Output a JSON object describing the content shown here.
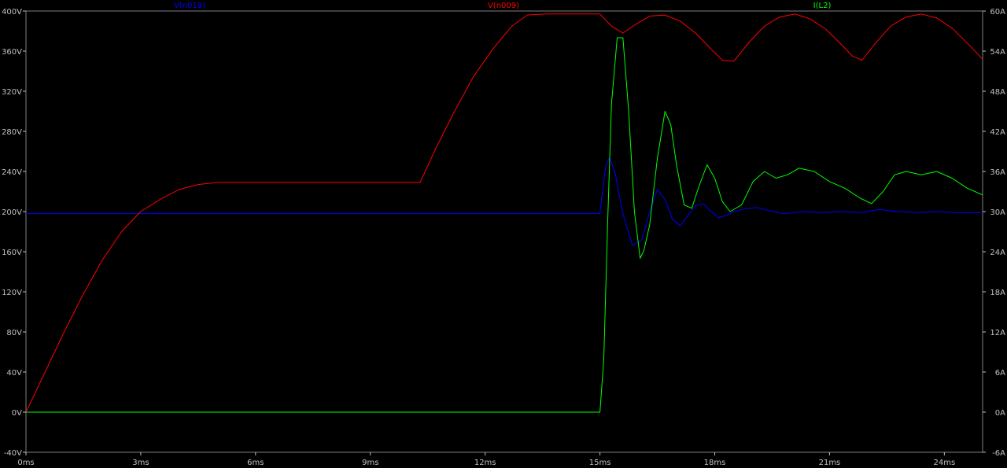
{
  "chart_data": {
    "type": "line",
    "x_axis": {
      "min": 0,
      "max": 25,
      "unit": "ms",
      "ticks": [
        0,
        3,
        6,
        9,
        12,
        15,
        18,
        21,
        24
      ],
      "tick_labels": [
        "0ms",
        "3ms",
        "6ms",
        "9ms",
        "12ms",
        "15ms",
        "18ms",
        "21ms",
        "24ms"
      ]
    },
    "y_left": {
      "min": -40,
      "max": 400,
      "unit": "V",
      "ticks": [
        -40,
        0,
        40,
        80,
        120,
        160,
        200,
        240,
        280,
        320,
        360,
        400
      ],
      "tick_labels": [
        "-40V",
        "0V",
        "40V",
        "80V",
        "120V",
        "160V",
        "200V",
        "240V",
        "280V",
        "320V",
        "360V",
        "400V"
      ]
    },
    "y_right": {
      "min": -6,
      "max": 60,
      "unit": "A",
      "ticks": [
        -6,
        0,
        6,
        12,
        18,
        24,
        30,
        36,
        42,
        48,
        54,
        60
      ],
      "tick_labels": [
        "-6A",
        "0A",
        "6A",
        "12A",
        "18A",
        "24A",
        "30A",
        "36A",
        "42A",
        "48A",
        "54A",
        "60A"
      ]
    },
    "grid": false,
    "series": [
      {
        "name": "V(n019)",
        "axis": "left",
        "color": "#0000ff",
        "stroke": 1,
        "x": [
          0,
          15,
          15.05,
          15.15,
          15.25,
          15.4,
          15.6,
          15.85,
          16.1,
          16.3,
          16.5,
          16.7,
          16.9,
          17.1,
          17.3,
          17.5,
          17.7,
          17.9,
          18.1,
          18.3,
          18.5,
          18.8,
          19.1,
          19.4,
          19.8,
          20.3,
          20.8,
          21.3,
          21.8,
          22.3,
          22.8,
          23.3,
          23.8,
          24.3,
          25
        ],
        "y": [
          198,
          198,
          215,
          245,
          254,
          238,
          198,
          166,
          172,
          200,
          222,
          212,
          192,
          186,
          196,
          206,
          208,
          200,
          194,
          196,
          200,
          203,
          204,
          201,
          198,
          200,
          199,
          200,
          199,
          202,
          200,
          199,
          200,
          199,
          199
        ]
      },
      {
        "name": "V(n009)",
        "axis": "left",
        "color": "#ff0000",
        "stroke": 1,
        "x": [
          0,
          0.5,
          1,
          1.5,
          2,
          2.5,
          3,
          3.5,
          4,
          4.5,
          5,
          5.5,
          10.3,
          10.7,
          11.2,
          11.7,
          12.2,
          12.7,
          13.1,
          13.6,
          15,
          15.3,
          15.6,
          15.9,
          16.3,
          16.7,
          17.1,
          17.5,
          17.9,
          18.2,
          18.5,
          18.9,
          19.3,
          19.7,
          20.1,
          20.5,
          20.9,
          21.3,
          21.6,
          21.85,
          22.2,
          22.6,
          23,
          23.4,
          23.8,
          24.2,
          24.6,
          25
        ],
        "y": [
          0,
          40,
          80,
          118,
          152,
          180,
          200,
          212,
          222,
          227,
          229,
          229,
          229,
          262,
          300,
          335,
          362,
          385,
          396,
          397,
          397,
          385,
          378,
          386,
          395,
          396,
          390,
          378,
          362,
          351,
          350,
          369,
          385,
          394,
          397,
          392,
          382,
          367,
          355,
          351,
          368,
          385,
          394,
          397,
          393,
          383,
          368,
          352
        ]
      },
      {
        "name": "I(L2)",
        "axis": "right",
        "color": "#00ff00",
        "stroke": 1,
        "x": [
          0,
          15,
          15.1,
          15.2,
          15.3,
          15.45,
          15.6,
          15.75,
          15.9,
          16.05,
          16.15,
          16.3,
          16.5,
          16.7,
          16.85,
          17.0,
          17.2,
          17.4,
          17.6,
          17.8,
          18.0,
          18.2,
          18.4,
          18.7,
          19.0,
          19.3,
          19.6,
          19.9,
          20.2,
          20.6,
          21.0,
          21.4,
          21.8,
          22.1,
          22.4,
          22.7,
          23.0,
          23.4,
          23.8,
          24.2,
          24.6,
          25
        ],
        "y": [
          0,
          0,
          8,
          28,
          46,
          56,
          56,
          45,
          30,
          23,
          24.2,
          28,
          38,
          45,
          43,
          37,
          31,
          30.5,
          34,
          37,
          35,
          31.5,
          30,
          31,
          34.5,
          36,
          35,
          35.5,
          36.5,
          36,
          34.5,
          33.5,
          32,
          31.2,
          33,
          35.5,
          36,
          35.5,
          36,
          35,
          33.5,
          32.5
        ]
      }
    ]
  }
}
